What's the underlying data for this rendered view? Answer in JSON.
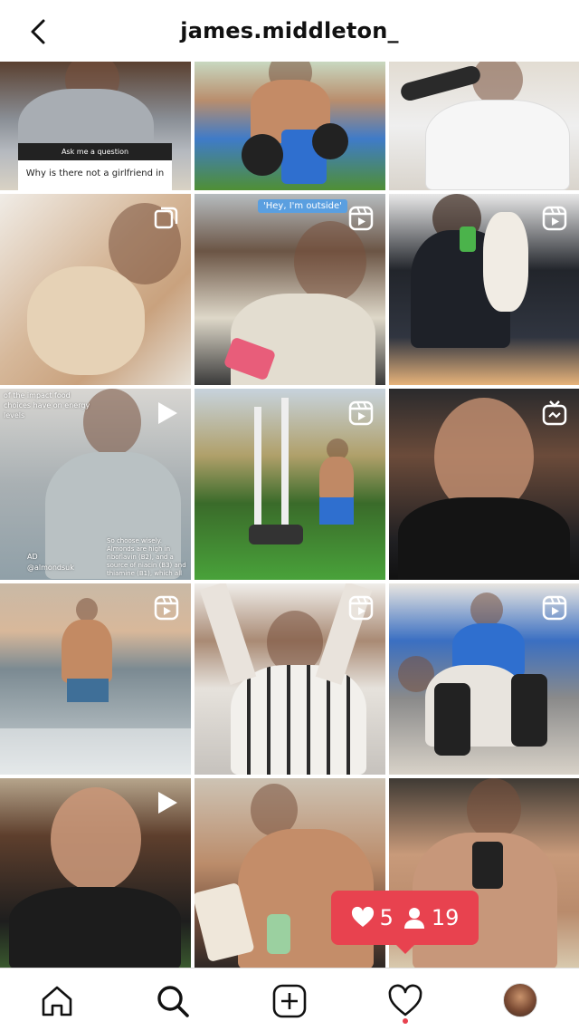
{
  "header": {
    "title": "james.middleton_",
    "back_icon": "chevron-left-icon"
  },
  "grid": {
    "tiles": [
      {
        "kind": "photo",
        "overlay_label": "Ask me a question",
        "overlay_question": "Why is there not a girlfriend in"
      },
      {
        "kind": "photo"
      },
      {
        "kind": "photo"
      },
      {
        "kind": "carousel",
        "badge_icon": "carousel-icon"
      },
      {
        "kind": "reel",
        "badge_icon": "reels-icon",
        "caption": "'Hey, I'm outside'"
      },
      {
        "kind": "reel",
        "badge_icon": "reels-icon"
      },
      {
        "kind": "video",
        "badge_icon": "play-icon",
        "caption_top": "of the impact food choices have on energy levels",
        "caption_ad": "AD",
        "caption_handle": "@almondsuk",
        "caption_bottom": "So choose wisely. Almonds are high in riboflavin (B2), and a source of niacin (B3) and thiamine (B1), which all"
      },
      {
        "kind": "reel",
        "badge_icon": "reels-icon"
      },
      {
        "kind": "igtv",
        "badge_icon": "igtv-icon"
      },
      {
        "kind": "reel",
        "badge_icon": "reels-icon"
      },
      {
        "kind": "reel",
        "badge_icon": "reels-icon"
      },
      {
        "kind": "reel",
        "badge_icon": "reels-icon"
      },
      {
        "kind": "video",
        "badge_icon": "play-icon"
      },
      {
        "kind": "photo"
      },
      {
        "kind": "photo"
      }
    ]
  },
  "notification": {
    "likes_count": "5",
    "followers_count": "19",
    "like_icon": "heart-icon",
    "follower_icon": "person-icon",
    "accent": "#e8424f"
  },
  "tabbar": {
    "items": [
      {
        "name": "home",
        "icon": "home-icon"
      },
      {
        "name": "search",
        "icon": "search-icon"
      },
      {
        "name": "new-post",
        "icon": "plus-square-icon"
      },
      {
        "name": "activity",
        "icon": "heart-outline-icon"
      },
      {
        "name": "profile",
        "icon": "avatar"
      }
    ]
  }
}
